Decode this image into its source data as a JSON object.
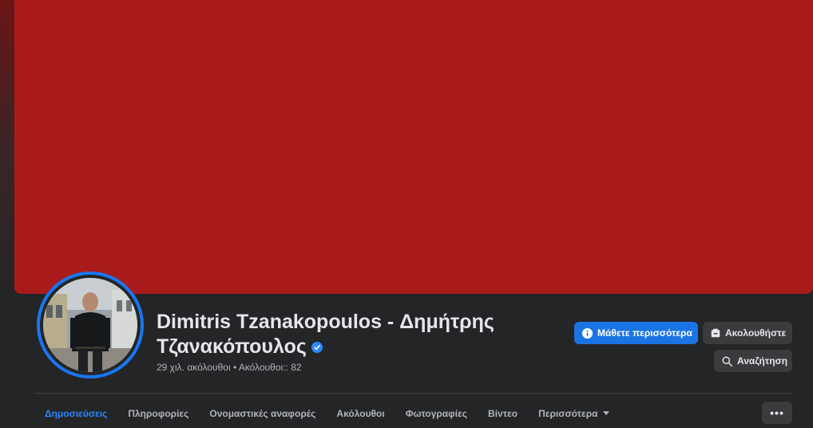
{
  "profile": {
    "name_line1": "Dimitris Tzanakopoulos - Δημήτρης",
    "name_line2": "Τζανακόπουλος",
    "verified_icon": "verified-badge-icon",
    "stats": "29 χιλ. ακόλουθοι • Ακόλουθοι:: 82"
  },
  "actions": {
    "learn_more": "Μάθετε περισσότερα",
    "follow": "Ακολουθήστε",
    "search": "Αναζήτηση"
  },
  "tabs": [
    {
      "label": "Δημοσιεύσεις",
      "active": true
    },
    {
      "label": "Πληροφορίες"
    },
    {
      "label": "Ονομαστικές αναφορές"
    },
    {
      "label": "Ακόλουθοι"
    },
    {
      "label": "Φωτογραφίες"
    },
    {
      "label": "Βίντεο"
    },
    {
      "label": "Περισσότερα"
    }
  ],
  "more_options": "•••",
  "colors": {
    "cover": "#a91b1b",
    "accent": "#1b74e4",
    "background": "#242526"
  }
}
